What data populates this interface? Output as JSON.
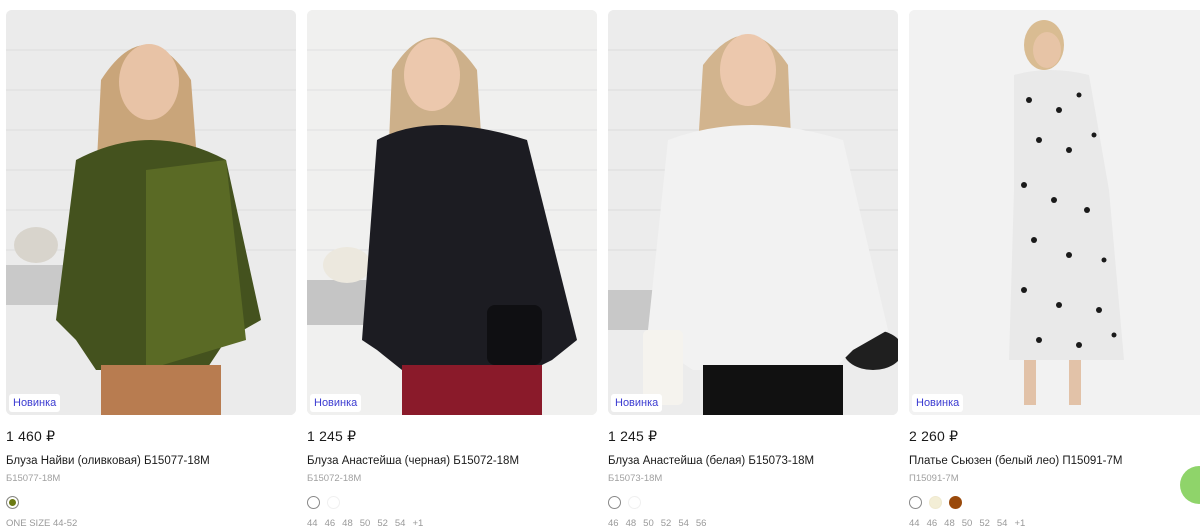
{
  "products": [
    {
      "badge": "Новинка",
      "price": "1 460 ₽",
      "title": "Блуза Найви (оливковая) Б15077-18М",
      "sku": "Б15077-18М",
      "colors": [
        "#6b7a12"
      ],
      "sizes": [
        "ONE SIZE 44-52"
      ]
    },
    {
      "badge": "Новинка",
      "price": "1 245 ₽",
      "title": "Блуза Анастейша (черная) Б15072-18М",
      "sku": "Б15072-18М",
      "colors": [
        "#ffffff",
        "#ffffff"
      ],
      "sizes": [
        "44",
        "46",
        "48",
        "50",
        "52",
        "54",
        "+1"
      ]
    },
    {
      "badge": "Новинка",
      "price": "1 245 ₽",
      "title": "Блуза Анастейша (белая) Б15073-18М",
      "sku": "Б15073-18М",
      "colors": [
        "#ffffff",
        "#ffffff"
      ],
      "sizes": [
        "46",
        "48",
        "50",
        "52",
        "54",
        "56"
      ]
    },
    {
      "badge": "Новинка",
      "price": "2 260 ₽",
      "title": "Платье Сьюзен (белый лео) П15091-7М",
      "sku": "П15091-7М",
      "colors": [
        "#ffffff",
        "#f3eed6",
        "#9a4a0c"
      ],
      "sizes": [
        "44",
        "46",
        "48",
        "50",
        "52",
        "54",
        "+1"
      ]
    }
  ]
}
